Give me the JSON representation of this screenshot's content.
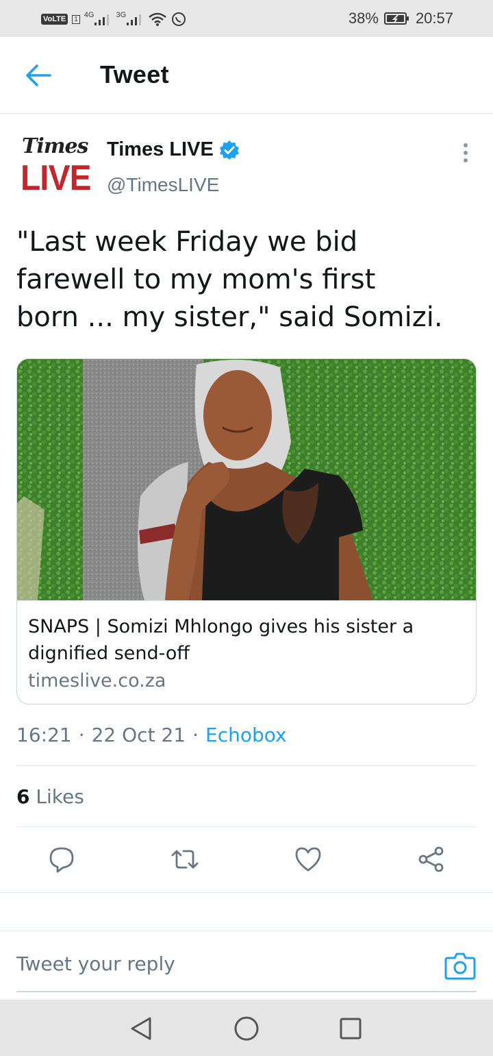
{
  "status_bar": {
    "volte": "VoLTE",
    "sim": "1",
    "sig1_label": "4G",
    "sig2_label": "3G",
    "battery": "38%",
    "time": "20:57"
  },
  "header": {
    "title": "Tweet",
    "back_icon": "arrow-left-icon"
  },
  "tweet": {
    "avatar_line1": "Times",
    "avatar_line2": "LIVE",
    "author_name": "Times LIVE",
    "verified_icon": "verified-badge-icon",
    "handle": "@TimesLIVE",
    "more_icon": "more-vertical-icon",
    "text_lines": [
      "\"Last week Friday we bid",
      "farewell to my mom's first",
      "born ... my sister,\" said Somizi."
    ],
    "card": {
      "title_lines": [
        "SNAPS | Somizi Mhlongo gives his sister a",
        "dignified send-off"
      ],
      "domain": "timeslive.co.za"
    },
    "time": "16:21",
    "date": "22 Oct 21",
    "source": "Echobox",
    "likes_count": "6",
    "likes_label": "Likes"
  },
  "actions": {
    "reply_icon": "reply-icon",
    "retweet_icon": "retweet-icon",
    "like_icon": "heart-icon",
    "share_icon": "share-icon"
  },
  "reply_box": {
    "placeholder": "Tweet your reply",
    "camera_icon": "camera-icon"
  },
  "colors": {
    "accent": "#1da1f2",
    "text": "#14171a",
    "secondary": "#657786",
    "brand_red": "#c1272d"
  }
}
